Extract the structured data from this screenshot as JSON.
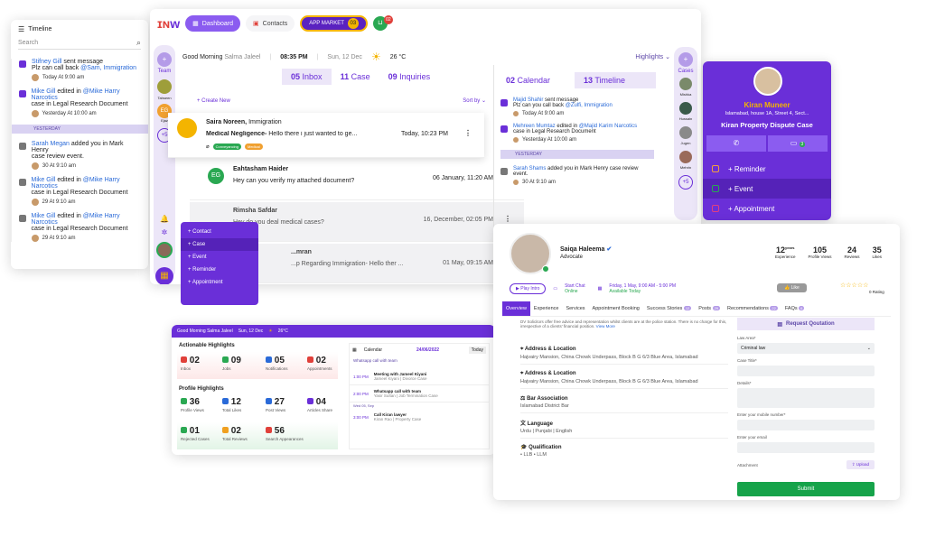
{
  "timeline": {
    "title": "Timeline",
    "search_placeholder": "Search",
    "items": [
      {
        "name": "Stifney Gill",
        "action": "sent message",
        "text": "Plz can call back",
        "mention": "@Sam, Immigration",
        "time": "Today At 9:00 am"
      },
      {
        "name": "Mike Gill",
        "action": "edited in",
        "mention": "@Mike Harry Narcotics",
        "text": "case in Legal Research Document",
        "time": "Yesterday At 10:00 am"
      },
      {
        "name": "Sarah Megan",
        "action": "added you in Mark Henry",
        "text": "case review event.",
        "time": "30 At 9:10 am"
      },
      {
        "name": "Mike Gill",
        "action": "edited in",
        "mention": "@Mike Harry Narcotics",
        "text": "case in Legal Research Document",
        "time": "29 At 9:10 am"
      },
      {
        "name": "Mike Gill",
        "action": "edited in",
        "mention": "@Mike Harry Narcotics",
        "text": "case in Legal Research Document",
        "time": "29 At 9:10 am"
      }
    ],
    "separator": "YESTERDAY"
  },
  "topnav": {
    "dashboard": "Dashboard",
    "contacts": "Contacts",
    "app_market": "APP MARKET",
    "app_market_count": "03",
    "cart_count": "02"
  },
  "greeting": {
    "text": "Good Morning",
    "user": "Salma Jaleel",
    "time": "08:35 PM",
    "date": "Sun, 12 Dec",
    "temp": "26 °C",
    "highlights": "Highlights"
  },
  "team": {
    "label": "Team",
    "members": [
      "Tahseen",
      "EG",
      "Ejaz"
    ],
    "more": "+5"
  },
  "cases_side": {
    "label": "Cases",
    "members": [
      "Mishka",
      "Hussain",
      "Jugen",
      "Mehrin"
    ],
    "more": "+5"
  },
  "tabs": {
    "inbox_count": "05",
    "inbox": "Inbox",
    "case_count": "11",
    "case": "Case",
    "inquiries_count": "09",
    "inquiries": "Inquiries",
    "calendar_count": "02",
    "calendar": "Calendar",
    "timeline_count": "13",
    "timeline": "Timeline"
  },
  "inbox": {
    "create": "+ Create New",
    "sort": "Sort by",
    "messages": [
      {
        "name": "Saira Noreen,",
        "topic": "Immigration",
        "subject": "Medical Negligence-",
        "preview": "Hello there i just wanted to ge...",
        "date": "Today, 10:23 PM",
        "tags": [
          "Conveyancing",
          "Medical"
        ]
      },
      {
        "name": "Eahtasham Haider",
        "preview": "Hey can you verify my attached document?",
        "date": "06 January, 11:20 AM",
        "initials": "EG"
      },
      {
        "name": "Rimsha Safdar",
        "preview": "Hey do you deal medical cases?",
        "date": "16, December, 02:05 PM"
      },
      {
        "name": "...mran",
        "preview": "...p Regarding Immigration- Hello ther ...",
        "date": "01 May, 09:15 AM"
      }
    ]
  },
  "right_timeline": {
    "items": [
      {
        "name": "Majid Shahir",
        "action": "sent message",
        "text": "Plz can you call back",
        "mention": "@Zulfi, Immigration",
        "time": "Today At 9:00 am"
      },
      {
        "name": "Mehreen Mumtaz",
        "action": "edited in",
        "mention": "@Majid Karim Narcotics",
        "text": "case in Legal Research Document",
        "time": "Yesterday At 10:00 am"
      },
      {
        "name": "Sarah Shams",
        "action": "added you in Mark Henry case review",
        "text": "event.",
        "time": "30 At 9:10 am"
      }
    ],
    "separator": "YESTERDAY"
  },
  "quick_menu": [
    "+ Contact",
    "+ Case",
    "+ Event",
    "+ Reminder",
    "+ Appointment"
  ],
  "kiran": {
    "name": "Kiran Muneer",
    "address": "Islamabad, house 1A, Street 4, Sect...",
    "case": "Kiran Property Dispute Case",
    "msg_count": "3",
    "actions": [
      "+ Reminder",
      "+ Event",
      "+ Appointment"
    ]
  },
  "dash": {
    "greeting": "Good Morning",
    "user": "Salma Jaleel",
    "date": "Sun, 12 Dec",
    "temp": "26°C",
    "actionable_title": "Actionable Highlights",
    "actionable": [
      {
        "n": "02",
        "l": "Inbox",
        "c": "#e0403a"
      },
      {
        "n": "09",
        "l": "Jobs",
        "c": "#2aa852"
      },
      {
        "n": "05",
        "l": "Notifications",
        "c": "#2a6ad8"
      },
      {
        "n": "02",
        "l": "Appointments",
        "c": "#e0403a"
      }
    ],
    "profile_title": "Profile Highlights",
    "profile": [
      {
        "n": "36",
        "l": "Profile Views",
        "c": "#2aa852"
      },
      {
        "n": "12",
        "l": "Total Likes",
        "c": "#2a6ad8"
      },
      {
        "n": "27",
        "l": "Post Views",
        "c": "#2a6ad8"
      },
      {
        "n": "04",
        "l": "Articles Share",
        "c": "#6a2fd8"
      },
      {
        "n": "01",
        "l": "Rejected Cases",
        "c": "#2aa852"
      },
      {
        "n": "02",
        "l": "Total Reviews",
        "c": "#f0a020"
      },
      {
        "n": "56",
        "l": "Search Appearances",
        "c": "#e0403a"
      }
    ],
    "calendar_label": "Calendar",
    "calendar_date": "24/06/2022",
    "today": "Today",
    "events": [
      {
        "time": "1:00 PM",
        "title": "Meeting with Jameel Kiyani",
        "sub": "Jameel Kiyani | Divorce Case"
      },
      {
        "time": "2:00 PM",
        "title": "Whatsapp call with team",
        "sub": "Yasir Sultan | Job Termination Case"
      },
      {
        "time": "3:00 PM",
        "title": "Call Kiran lawyer",
        "sub": "Kiran Rao | Property Case"
      }
    ],
    "day_sep": "Wed 05, Sep"
  },
  "profile": {
    "name": "Saiqa Haleema",
    "role": "Advocate",
    "stats": [
      {
        "n": "12",
        "sup": "years",
        "l": "Experience"
      },
      {
        "n": "105",
        "l": "Profile Views"
      },
      {
        "n": "24",
        "l": "Reviews"
      },
      {
        "n": "35",
        "l": "Likes"
      }
    ],
    "play_intro": "Play Intro",
    "start_chat": "Start Chat",
    "online": "Online",
    "availability": "Friday, 1 May, 9:00 AM - 5:00 PM",
    "available_today": "Available Today",
    "like": "Like",
    "rating_label": "0 Rating",
    "tabs": [
      "Overview",
      "Experience",
      "Services",
      "Appointment Booking",
      "Success Stories",
      "Posts",
      "Recommendations",
      "FAQs"
    ],
    "tab_counts": {
      "Success Stories": "12",
      "Posts": "29",
      "Recommendations": "22",
      "FAQs": "6"
    },
    "intro": "DV Solicitors offer free advice and representation whilst clients are at the police station. There is no charge for this, irrespective of a clients' financial position.",
    "view_more": "View More",
    "sections": [
      {
        "t": "Address & Location",
        "v": "Hajvairy Mansion, China Chowk Underpass, Block B G 6/3 Blue Area, Islamabad"
      },
      {
        "t": "Address & Location",
        "v": "Hajvairy Mansion, China Chowk Underpass, Block B G 6/3 Blue Area, Islamabad"
      },
      {
        "t": "Bar Association",
        "v": "Islamabad District Bar"
      },
      {
        "t": "Language",
        "v": "Urdu  |  Punjabi  |  English"
      },
      {
        "t": "Qualification",
        "v": "• LLB    • LLM"
      }
    ],
    "form": {
      "title": "Request Qoutation",
      "area_label": "Law Area*",
      "area_value": "Criminal law",
      "case_title": "Case Title*",
      "details": "Details*",
      "mobile": "Enter your mobile number*",
      "email": "Enter your email",
      "attachment": "Attachment",
      "upload": "Upload",
      "submit": "Submit"
    }
  }
}
